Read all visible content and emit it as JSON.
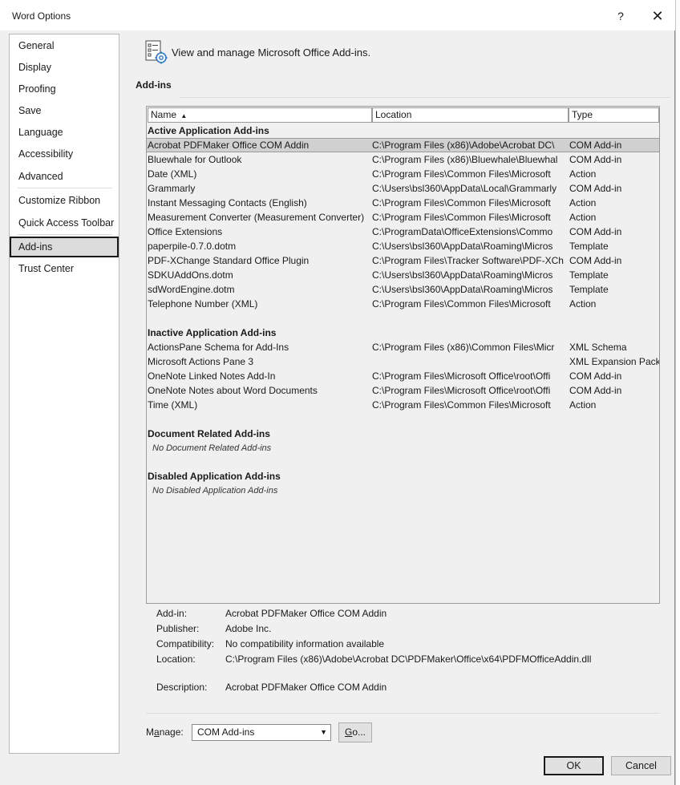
{
  "window": {
    "title": "Word Options",
    "help": "?",
    "close": "✕"
  },
  "nav": {
    "items": [
      {
        "label": "General"
      },
      {
        "label": "Display"
      },
      {
        "label": "Proofing"
      },
      {
        "label": "Save"
      },
      {
        "label": "Language"
      },
      {
        "label": "Accessibility"
      },
      {
        "label": "Advanced"
      },
      {
        "label": "Customize Ribbon"
      },
      {
        "label": "Quick Access Toolbar"
      },
      {
        "label": "Add-ins"
      },
      {
        "label": "Trust Center"
      }
    ],
    "selected": "Add-ins"
  },
  "header": {
    "text": "View and manage Microsoft Office Add-ins.",
    "section": "Add-ins"
  },
  "table": {
    "columns": {
      "name": "Name",
      "sort_indicator": "▲",
      "location": "Location",
      "type": "Type"
    },
    "active_heading": "Active Application Add-ins",
    "active": [
      {
        "name": "Acrobat PDFMaker Office COM Addin",
        "location": "C:\\Program Files (x86)\\Adobe\\Acrobat DC\\",
        "type": "COM Add-in"
      },
      {
        "name": "Bluewhale for Outlook",
        "location": "C:\\Program Files (x86)\\Bluewhale\\Bluewhal",
        "type": "COM Add-in"
      },
      {
        "name": "Date (XML)",
        "location": "C:\\Program Files\\Common Files\\Microsoft",
        "type": "Action"
      },
      {
        "name": "Grammarly",
        "location": "C:\\Users\\bsl360\\AppData\\Local\\Grammarly",
        "type": "COM Add-in"
      },
      {
        "name": "Instant Messaging Contacts (English)",
        "location": "C:\\Program Files\\Common Files\\Microsoft",
        "type": "Action"
      },
      {
        "name": "Measurement Converter (Measurement Converter)",
        "location": "C:\\Program Files\\Common Files\\Microsoft",
        "type": "Action"
      },
      {
        "name": "Office Extensions",
        "location": "C:\\ProgramData\\OfficeExtensions\\Commo",
        "type": "COM Add-in"
      },
      {
        "name": "paperpile-0.7.0.dotm",
        "location": "C:\\Users\\bsl360\\AppData\\Roaming\\Micros",
        "type": "Template"
      },
      {
        "name": "PDF-XChange Standard Office Plugin",
        "location": "C:\\Program Files\\Tracker Software\\PDF-XCh",
        "type": "COM Add-in"
      },
      {
        "name": "SDKUAddOns.dotm",
        "location": "C:\\Users\\bsl360\\AppData\\Roaming\\Micros",
        "type": "Template"
      },
      {
        "name": "sdWordEngine.dotm",
        "location": "C:\\Users\\bsl360\\AppData\\Roaming\\Micros",
        "type": "Template"
      },
      {
        "name": "Telephone Number (XML)",
        "location": "C:\\Program Files\\Common Files\\Microsoft",
        "type": "Action"
      }
    ],
    "inactive_heading": "Inactive Application Add-ins",
    "inactive": [
      {
        "name": "ActionsPane Schema for Add-Ins",
        "location": "C:\\Program Files (x86)\\Common Files\\Micr",
        "type": "XML Schema"
      },
      {
        "name": "Microsoft Actions Pane 3",
        "location": "",
        "type": "XML Expansion Pack"
      },
      {
        "name": "OneNote Linked Notes Add-In",
        "location": "C:\\Program Files\\Microsoft Office\\root\\Offi",
        "type": "COM Add-in"
      },
      {
        "name": "OneNote Notes about Word Documents",
        "location": "C:\\Program Files\\Microsoft Office\\root\\Offi",
        "type": "COM Add-in"
      },
      {
        "name": "Time (XML)",
        "location": "C:\\Program Files\\Common Files\\Microsoft",
        "type": "Action"
      }
    ],
    "document_heading": "Document Related Add-ins",
    "document_empty": "No Document Related Add-ins",
    "disabled_heading": "Disabled Application Add-ins",
    "disabled_empty": "No Disabled Application Add-ins"
  },
  "details": {
    "addin_label": "Add-in:",
    "addin": "Acrobat PDFMaker Office COM Addin",
    "publisher_label": "Publisher:",
    "publisher": "Adobe Inc.",
    "compat_label": "Compatibility:",
    "compat": "No compatibility information available",
    "location_label": "Location:",
    "location": "C:\\Program Files (x86)\\Adobe\\Acrobat DC\\PDFMaker\\Office\\x64\\PDFMOfficeAddin.dll",
    "description_label": "Description:",
    "description": "Acrobat PDFMaker Office COM Addin"
  },
  "manage": {
    "label_pre": "M",
    "label_accel": "a",
    "label_post": "nage:",
    "selected": "COM Add-ins",
    "go_pre": "",
    "go_accel": "G",
    "go_post": "o..."
  },
  "footer": {
    "ok": "OK",
    "cancel": "Cancel"
  }
}
